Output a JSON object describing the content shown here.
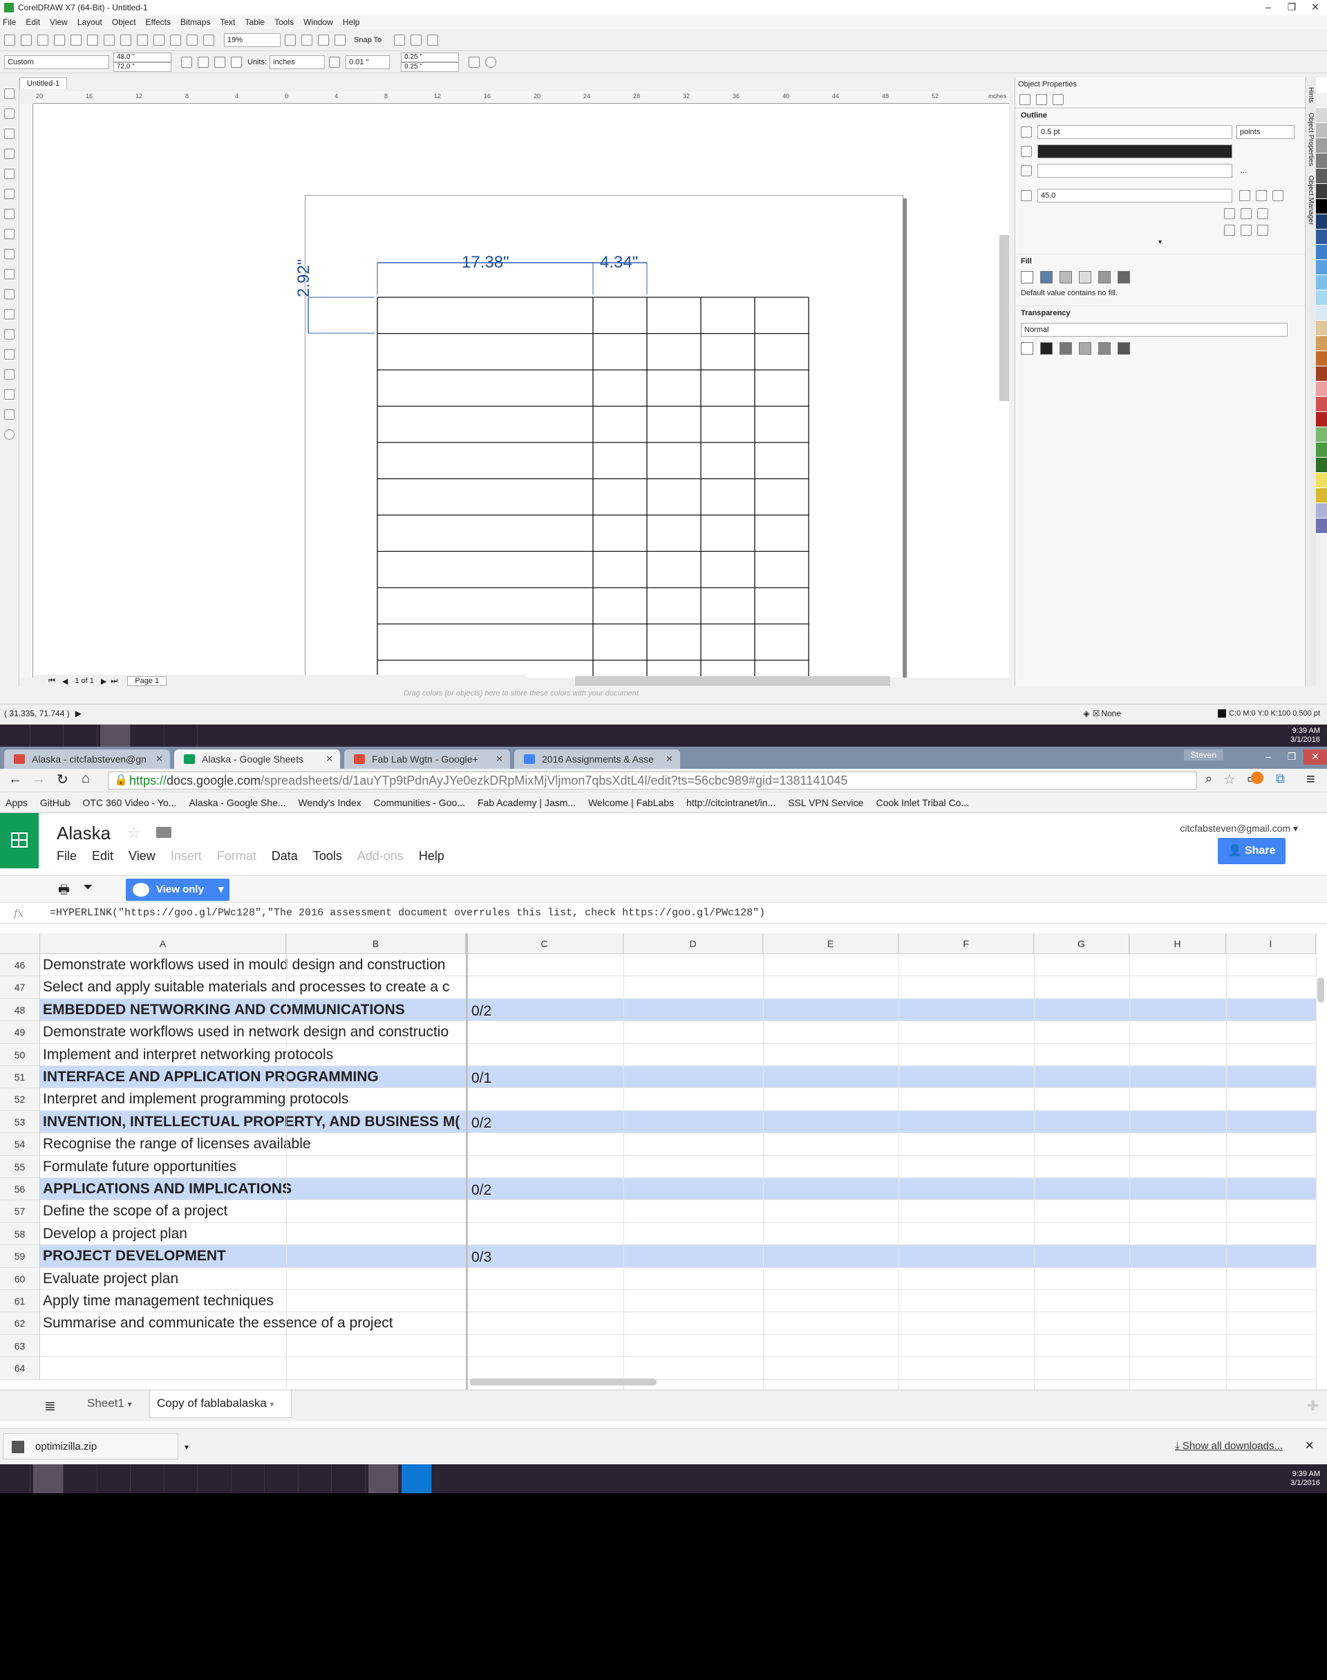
{
  "corel": {
    "title": "CorelDRAW X7 (64-Bit) - Untitled-1",
    "menu": [
      "File",
      "Edit",
      "View",
      "Layout",
      "Object",
      "Effects",
      "Bitmaps",
      "Text",
      "Table",
      "Tools",
      "Window",
      "Help"
    ],
    "zoom": "19%",
    "snap_to": "Snap To",
    "page_size": "Custom",
    "width": "48.0 \"",
    "height": "72.0 \"",
    "units_label": "Units:",
    "units": "inches",
    "nudge": "0.01 \"",
    "dup_x": "0.25 \"",
    "dup_y": "0.25 \"",
    "doc_tab": "Untitled-1",
    "ruler_unit": "inches",
    "ruler_ticks": [
      "20",
      "16",
      "12",
      "8",
      "4",
      "0",
      "4",
      "8",
      "12",
      "16",
      "20",
      "24",
      "28",
      "32",
      "36",
      "40",
      "44",
      "48",
      "52"
    ],
    "dim_width": "17.38\"",
    "dim_col": "4.34\"",
    "dim_row": "2.92\"",
    "page_count": "1 of 1",
    "page_tab": "Page 1",
    "color_well_hint": "Drag colors (or objects) here to store these colors with your document",
    "status_coords": "( 31.335, 71.744 )",
    "status_fill": "None",
    "status_outline": "C:0 M:0 Y:0 K:100  0.500 pt",
    "obj_props": {
      "title": "Object Properties",
      "outline_label": "Outline",
      "outline_width": "0.5 pt",
      "outline_units": "points",
      "miter": "45.0",
      "fill_label": "Fill",
      "fill_note": "Default value contains no fill.",
      "transparency_label": "Transparency",
      "transparency_mode": "Normal"
    },
    "dock_tabs": [
      "Hints",
      "Object Properties",
      "Object Manager"
    ],
    "palette": [
      "#ffffff",
      "#f0f0f0",
      "#d8d8d8",
      "#bdbdbd",
      "#9e9e9e",
      "#7d7d7d",
      "#5e5e5e",
      "#3c3c3c",
      "#000000",
      "#1b3e6e",
      "#2d5a9a",
      "#3f7fc9",
      "#5aa0e0",
      "#7dbfe8",
      "#a7d7f0",
      "#d6e9f5",
      "#e0c89a",
      "#d49e5a",
      "#c06a2a",
      "#a04020",
      "#e8a0a0",
      "#d05050",
      "#b02020",
      "#7ab870",
      "#4e9a44",
      "#2e6e28",
      "#f0e060",
      "#d8b830",
      "#b0b0d8",
      "#7070b0"
    ],
    "clock_time": "9:39 AM",
    "clock_date": "3/1/2016"
  },
  "chrome": {
    "tabs": [
      {
        "label": "Alaska - citcfabsteven@gn",
        "color": "#d54b3d"
      },
      {
        "label": "Alaska - Google Sheets",
        "color": "#0f9d58"
      },
      {
        "label": "Fab Lab Wgtn - Google+",
        "color": "#dd4b39"
      },
      {
        "label": "2016 Assignments & Asse",
        "color": "#4285f4"
      }
    ],
    "profile": "Steven",
    "url_https": "https://",
    "url_host": "docs.google.com",
    "url_path": "/spreadsheets/d/1auYTp9tPdnAyJYe0ezkDRpMixMjVljmon7qbsXdtL4l/edit?ts=56cbc989#gid=1381141045",
    "bookmarks": [
      "Apps",
      "GitHub",
      "OTC 360 Video - Yo...",
      "Alaska - Google She...",
      "Wendy's Index",
      "Communities - Goo...",
      "Fab Academy | Jasm...",
      "Welcome | FabLabs",
      "http://citcintranet/in...",
      "SSL VPN Service",
      "Cook Inlet Tribal Co..."
    ]
  },
  "sheet": {
    "title": "Alaska",
    "menu": [
      {
        "label": "File",
        "dis": false
      },
      {
        "label": "Edit",
        "dis": false
      },
      {
        "label": "View",
        "dis": false
      },
      {
        "label": "Insert",
        "dis": true
      },
      {
        "label": "Format",
        "dis": true
      },
      {
        "label": "Data",
        "dis": false
      },
      {
        "label": "Tools",
        "dis": false
      },
      {
        "label": "Add-ons",
        "dis": true
      },
      {
        "label": "Help",
        "dis": false
      }
    ],
    "account": "citcfabsteven@gmail.com",
    "share": "Share",
    "view_only": "View only",
    "fx": "fx",
    "formula": "=HYPERLINK(\"https://goo.gl/PWc128\",\"The 2016 assessment document overrules this list, check https://goo.gl/PWc128\")",
    "columns": [
      "A",
      "B",
      "C",
      "D",
      "E",
      "F",
      "G",
      "H",
      "I"
    ],
    "rows": [
      {
        "n": "46",
        "a": "Demonstrate workflows used in mould design and construction",
        "c": "",
        "hl": false
      },
      {
        "n": "47",
        "a": "Select and apply suitable materials and processes to create a c",
        "c": "",
        "hl": false
      },
      {
        "n": "48",
        "a": "EMBEDDED NETWORKING AND COMMUNICATIONS",
        "c": "0/2",
        "hl": true
      },
      {
        "n": "49",
        "a": "Demonstrate workflows used in network design and constructio",
        "c": "",
        "hl": false
      },
      {
        "n": "50",
        "a": "Implement and interpret networking protocols",
        "c": "",
        "hl": false
      },
      {
        "n": "51",
        "a": "INTERFACE AND APPLICATION PROGRAMMING",
        "c": "0/1",
        "hl": true
      },
      {
        "n": "52",
        "a": "Interpret and implement programming protocols",
        "c": "",
        "hl": false
      },
      {
        "n": "53",
        "a": "INVENTION, INTELLECTUAL PROPERTY, AND BUSINESS M(",
        "c": "0/2",
        "hl": true
      },
      {
        "n": "54",
        "a": "Recognise the range of licenses available",
        "c": "",
        "hl": false
      },
      {
        "n": "55",
        "a": "Formulate future opportunities",
        "c": "",
        "hl": false
      },
      {
        "n": "56",
        "a": "APPLICATIONS AND IMPLICATIONS",
        "c": "0/2",
        "hl": true
      },
      {
        "n": "57",
        "a": "Define the scope of a project",
        "c": "",
        "hl": false
      },
      {
        "n": "58",
        "a": "Develop a project plan",
        "c": "",
        "hl": false
      },
      {
        "n": "59",
        "a": "PROJECT DEVELOPMENT",
        "c": "0/3",
        "hl": true
      },
      {
        "n": "60",
        "a": "Evaluate project plan",
        "c": "",
        "hl": false
      },
      {
        "n": "61",
        "a": "Apply time management techniques",
        "c": "",
        "hl": false
      },
      {
        "n": "62",
        "a": "Summarise and communicate the essence of a project",
        "c": "",
        "hl": false
      },
      {
        "n": "63",
        "a": "",
        "c": "",
        "hl": false
      },
      {
        "n": "64",
        "a": "",
        "c": "",
        "hl": false
      }
    ],
    "sheet_tabs": [
      "Sheet1",
      "Copy of fablabalaska"
    ],
    "download_file": "optimizilla.zip",
    "show_downloads": "Show all downloads...",
    "highlight_color": "#c9daf8"
  }
}
